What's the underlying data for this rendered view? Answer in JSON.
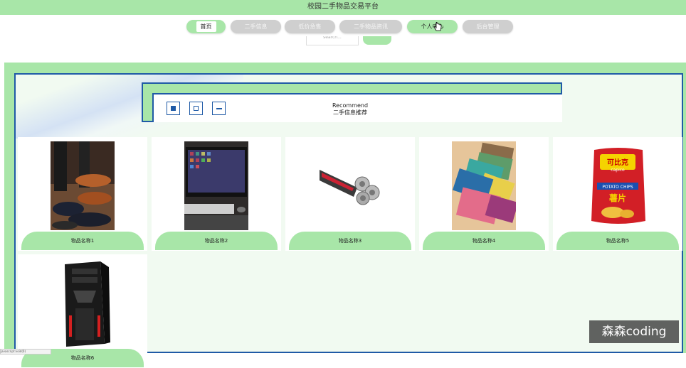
{
  "app": {
    "title": "校园二手物品交易平台"
  },
  "nav": {
    "items": [
      {
        "label": "首页",
        "state": "active"
      },
      {
        "label": "二手信息",
        "state": "normal"
      },
      {
        "label": "低价急售",
        "state": "normal"
      },
      {
        "label": "二手物品资讯",
        "state": "normal"
      },
      {
        "label": "个人中心",
        "state": "hover"
      },
      {
        "label": "后台管理",
        "state": "normal"
      }
    ]
  },
  "search": {
    "placeholder": "search..."
  },
  "recommend": {
    "title_en": "Recommend",
    "title_cn": "二手信息推荐"
  },
  "products": [
    {
      "name": "物品名称1",
      "image": "leather-shoes"
    },
    {
      "name": "物品名称2",
      "image": "desktop-computer"
    },
    {
      "name": "物品名称3",
      "image": "electric-shaver"
    },
    {
      "name": "物品名称4",
      "image": "wallets"
    },
    {
      "name": "物品名称5",
      "image": "potato-chips"
    },
    {
      "name": "物品名称6",
      "image": "pc-case"
    }
  ],
  "watermark": "森森coding",
  "status_url": "javascript:void(0)",
  "colors": {
    "accent_green": "#a8e6a8",
    "border_blue": "#1f5aa6",
    "panel_bg": "#f1faf1",
    "inactive_gray": "#cfcfcf"
  }
}
